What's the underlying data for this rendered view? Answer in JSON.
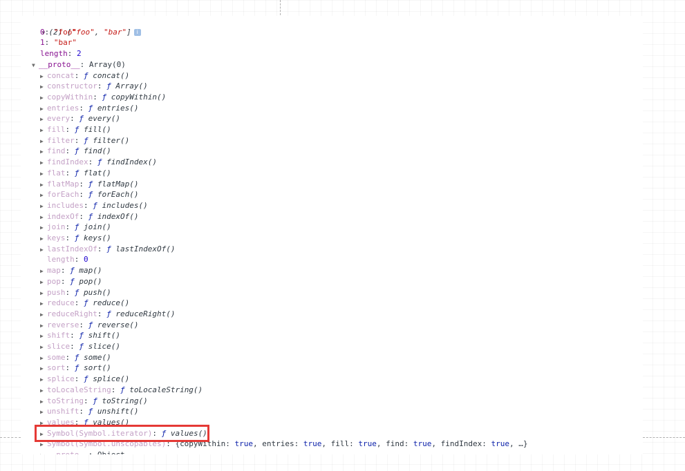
{
  "header": {
    "count": "(2)",
    "preview_open": "[",
    "preview_item_1": "\"foo\"",
    "preview_sep": ", ",
    "preview_item_2": "\"bar\"",
    "preview_close": "]",
    "info_icon": "i"
  },
  "own_props": [
    {
      "key": "0",
      "value": "\"foo\"",
      "value_type": "string"
    },
    {
      "key": "1",
      "value": "\"bar\"",
      "value_type": "string"
    },
    {
      "key": "length",
      "value": "2",
      "value_type": "number"
    }
  ],
  "proto_header": {
    "key": "__proto__",
    "value": "Array(0)"
  },
  "proto_methods": [
    {
      "key": "concat",
      "fn": "concat()",
      "expandable": true
    },
    {
      "key": "constructor",
      "fn": "Array()",
      "expandable": true
    },
    {
      "key": "copyWithin",
      "fn": "copyWithin()",
      "expandable": true
    },
    {
      "key": "entries",
      "fn": "entries()",
      "expandable": true
    },
    {
      "key": "every",
      "fn": "every()",
      "expandable": true
    },
    {
      "key": "fill",
      "fn": "fill()",
      "expandable": true
    },
    {
      "key": "filter",
      "fn": "filter()",
      "expandable": true
    },
    {
      "key": "find",
      "fn": "find()",
      "expandable": true
    },
    {
      "key": "findIndex",
      "fn": "findIndex()",
      "expandable": true
    },
    {
      "key": "flat",
      "fn": "flat()",
      "expandable": true
    },
    {
      "key": "flatMap",
      "fn": "flatMap()",
      "expandable": true
    },
    {
      "key": "forEach",
      "fn": "forEach()",
      "expandable": true
    },
    {
      "key": "includes",
      "fn": "includes()",
      "expandable": true
    },
    {
      "key": "indexOf",
      "fn": "indexOf()",
      "expandable": true
    },
    {
      "key": "join",
      "fn": "join()",
      "expandable": true
    },
    {
      "key": "keys",
      "fn": "keys()",
      "expandable": true
    },
    {
      "key": "lastIndexOf",
      "fn": "lastIndexOf()",
      "expandable": true
    },
    {
      "key": "length",
      "value": "0",
      "expandable": false
    },
    {
      "key": "map",
      "fn": "map()",
      "expandable": true
    },
    {
      "key": "pop",
      "fn": "pop()",
      "expandable": true
    },
    {
      "key": "push",
      "fn": "push()",
      "expandable": true
    },
    {
      "key": "reduce",
      "fn": "reduce()",
      "expandable": true
    },
    {
      "key": "reduceRight",
      "fn": "reduceRight()",
      "expandable": true
    },
    {
      "key": "reverse",
      "fn": "reverse()",
      "expandable": true
    },
    {
      "key": "shift",
      "fn": "shift()",
      "expandable": true
    },
    {
      "key": "slice",
      "fn": "slice()",
      "expandable": true
    },
    {
      "key": "some",
      "fn": "some()",
      "expandable": true
    },
    {
      "key": "sort",
      "fn": "sort()",
      "expandable": true
    },
    {
      "key": "splice",
      "fn": "splice()",
      "expandable": true
    },
    {
      "key": "toLocaleString",
      "fn": "toLocaleString()",
      "expandable": true
    },
    {
      "key": "toString",
      "fn": "toString()",
      "expandable": true
    },
    {
      "key": "unshift",
      "fn": "unshift()",
      "expandable": true
    },
    {
      "key": "values",
      "fn": "values()",
      "expandable": true
    },
    {
      "key": "Symbol(Symbol.iterator)",
      "fn": "values()",
      "expandable": true,
      "highlighted": true
    }
  ],
  "unscopables": {
    "key": "Symbol(Symbol.unscopables)",
    "open": "{",
    "entries": [
      {
        "key": "copyWithin",
        "value": "true"
      },
      {
        "key": "entries",
        "value": "true"
      },
      {
        "key": "fill",
        "value": "true"
      },
      {
        "key": "find",
        "value": "true"
      },
      {
        "key": "findIndex",
        "value": "true"
      }
    ],
    "ellipsis": "…}"
  },
  "last_proto": {
    "key": "__proto__",
    "value": "Object"
  },
  "symbols": {
    "fn_glyph": "ƒ",
    "expanded": "▼",
    "collapsed": "▶"
  },
  "colors": {
    "own_key": "#881391",
    "proto_key": "#c4a1c6",
    "string": "#c41a16",
    "number": "#1c00cf",
    "function_glyph": "#0d22aa",
    "highlight_border": "#e53935"
  }
}
